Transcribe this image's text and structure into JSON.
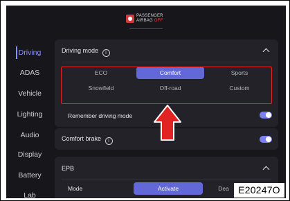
{
  "status": {
    "airbag_line1": "PASSENGER",
    "airbag_line2": "AIRBAG",
    "airbag_state": "OFF"
  },
  "sidebar": {
    "items": [
      {
        "label": "Driving"
      },
      {
        "label": "ADAS"
      },
      {
        "label": "Vehicle"
      },
      {
        "label": "Lighting"
      },
      {
        "label": "Audio"
      },
      {
        "label": "Display"
      },
      {
        "label": "Battery"
      },
      {
        "label": "Lab"
      }
    ],
    "active": "Driving"
  },
  "driving_mode": {
    "title": "Driving mode",
    "info_glyph": "i",
    "options": [
      {
        "label": "ECO"
      },
      {
        "label": "Comfort"
      },
      {
        "label": "Sports"
      },
      {
        "label": "Snowfield"
      },
      {
        "label": "Off-road"
      },
      {
        "label": "Custom"
      }
    ],
    "selected": "Comfort",
    "remember_label": "Remember driving mode",
    "remember_enabled": true
  },
  "comfort_brake": {
    "title": "Comfort brake",
    "info_glyph": "i",
    "enabled": true
  },
  "epb": {
    "title": "EPB",
    "mode_label": "Mode",
    "activate_label": "Activate",
    "deactivate_label": "Dea"
  },
  "figure_code": "E20247O",
  "colors": {
    "accent": "#6268d8",
    "highlight": "#e02424",
    "background": "#17171b",
    "card": "#222228"
  }
}
